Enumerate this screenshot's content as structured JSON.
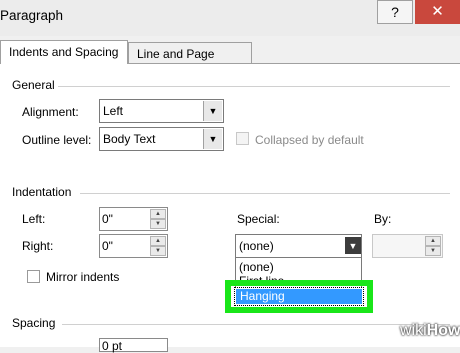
{
  "window": {
    "title": "Paragraph",
    "help_label": "?",
    "close_label": "✕"
  },
  "tabs": [
    {
      "label": "Indents and Spacing",
      "active": true
    },
    {
      "label": "Line and Page Breaks",
      "active": false
    }
  ],
  "general": {
    "section_label": "General",
    "alignment_label": "Alignment:",
    "alignment_value": "Left",
    "outline_label": "Outline level:",
    "outline_value": "Body Text",
    "collapsed_label": "Collapsed by default"
  },
  "indentation": {
    "section_label": "Indentation",
    "left_label": "Left:",
    "left_value": "0\"",
    "right_label": "Right:",
    "right_value": "0\"",
    "special_label": "Special:",
    "special_value": "(none)",
    "by_label": "By:",
    "mirror_label": "Mirror indents",
    "dropdown_options": [
      "(none)",
      "First line",
      "Hanging"
    ],
    "selected_option": "Hanging"
  },
  "spacing": {
    "section_label": "Spacing",
    "before_partial": "0 pt"
  },
  "watermark": {
    "part1": "wiki",
    "part2": "How"
  },
  "colors": {
    "highlight_box": "#19e619",
    "selection": "#3399ff",
    "close_button": "#c9483d"
  }
}
